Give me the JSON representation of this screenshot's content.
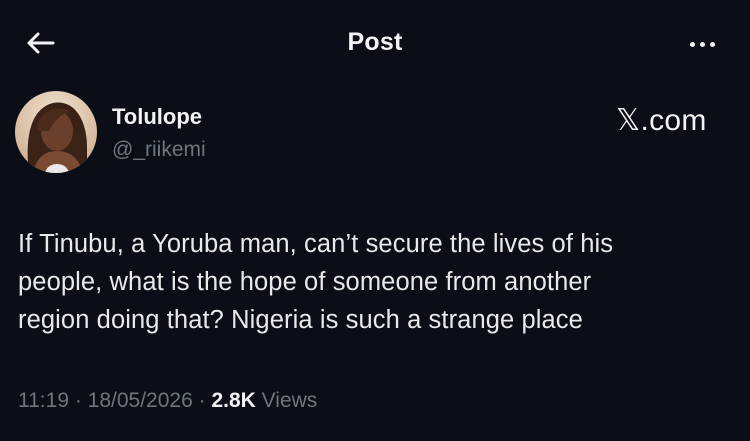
{
  "header": {
    "title": "Post",
    "back_icon": "arrow-left-icon",
    "more_icon": "more-horizontal-icon"
  },
  "author": {
    "name": "Tolulope",
    "handle": "@_riikemi"
  },
  "watermark": "𝕏.com",
  "tweet": {
    "lines": [
      "If Tinubu, a Yoruba man, can’t secure the lives of his",
      "people, what is the hope of someone from another",
      "region doing that? Nigeria is such a strange place"
    ]
  },
  "meta": {
    "time": "11:19",
    "separator": " · ",
    "date": "18/05/2026",
    "views_count": "2.8K",
    "views_label": " Views"
  },
  "colors": {
    "background": "#0b0e17",
    "text_primary": "#e7e9ea",
    "text_secondary": "#6e767d"
  }
}
